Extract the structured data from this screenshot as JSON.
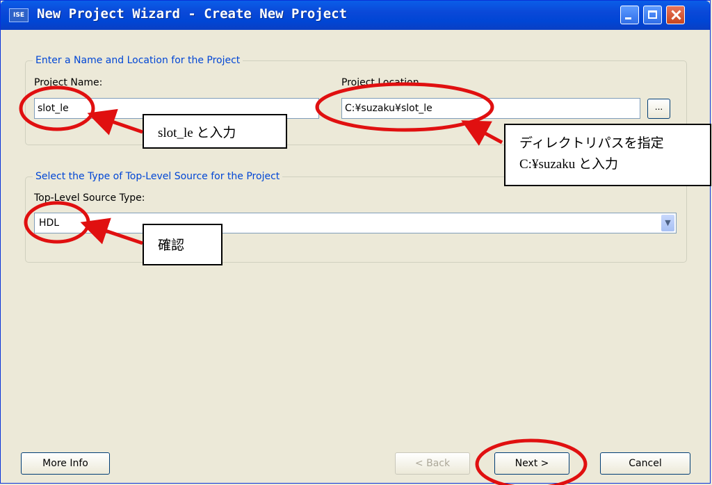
{
  "window": {
    "title": "New Project Wizard - Create New Project",
    "app_icon": "ISE"
  },
  "group1": {
    "legend": "Enter a Name and Location for the Project",
    "project_name_label": "Project Name:",
    "project_name_value": "slot_le",
    "project_location_label": "Project Location",
    "project_location_value": "C:¥suzaku¥slot_le",
    "browse_label": "..."
  },
  "group2": {
    "legend": "Select the Type of Top-Level Source for the Project",
    "source_type_label": "Top-Level Source Type:",
    "source_type_value": "HDL"
  },
  "buttons": {
    "more_info": "More Info",
    "back": "< Back",
    "next": "Next >",
    "cancel": "Cancel"
  },
  "annotations": {
    "name_note": "slot_le と入力",
    "path_note_line1": "ディレクトリパスを指定",
    "path_note_line2": "C:¥suzaku と入力",
    "confirm_note": "確認"
  },
  "colors": {
    "annotation_red": "#e01010",
    "legend_blue": "#0046d5",
    "title_blue": "#0a5ee8"
  }
}
